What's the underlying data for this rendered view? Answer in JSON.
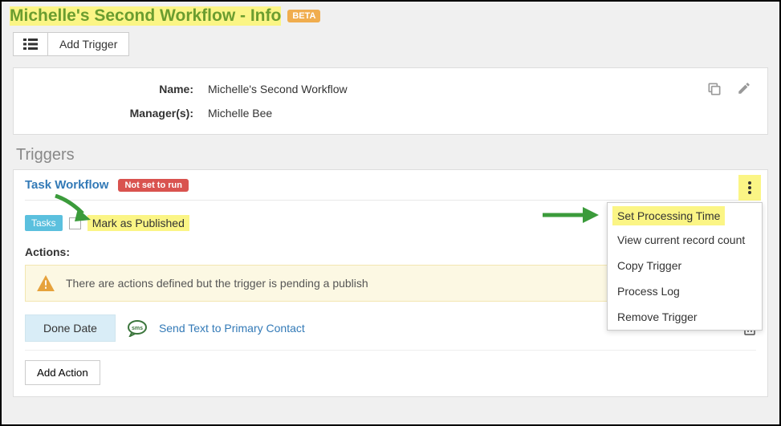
{
  "header": {
    "title": "Michelle's Second Workflow - Info",
    "beta_badge": "BETA"
  },
  "toolbar": {
    "add_trigger": "Add Trigger"
  },
  "info": {
    "name_label": "Name:",
    "name_value": "Michelle's Second Workflow",
    "managers_label": "Manager(s):",
    "managers_value": "Michelle Bee"
  },
  "sections": {
    "triggers_title": "Triggers"
  },
  "trigger": {
    "title": "Task Workflow",
    "status": "Not set to run",
    "tasks_badge": "Tasks",
    "mark_published": "Mark as Published",
    "actions_label": "Actions:",
    "warning_text": "There are actions defined but the trigger is pending a publish",
    "done_date": "Done Date",
    "sms_action": "Send Text to Primary Contact",
    "add_action": "Add Action"
  },
  "menu": {
    "items": [
      "Set Processing Time",
      "View current record count",
      "Copy Trigger",
      "Process Log",
      "Remove Trigger"
    ]
  }
}
